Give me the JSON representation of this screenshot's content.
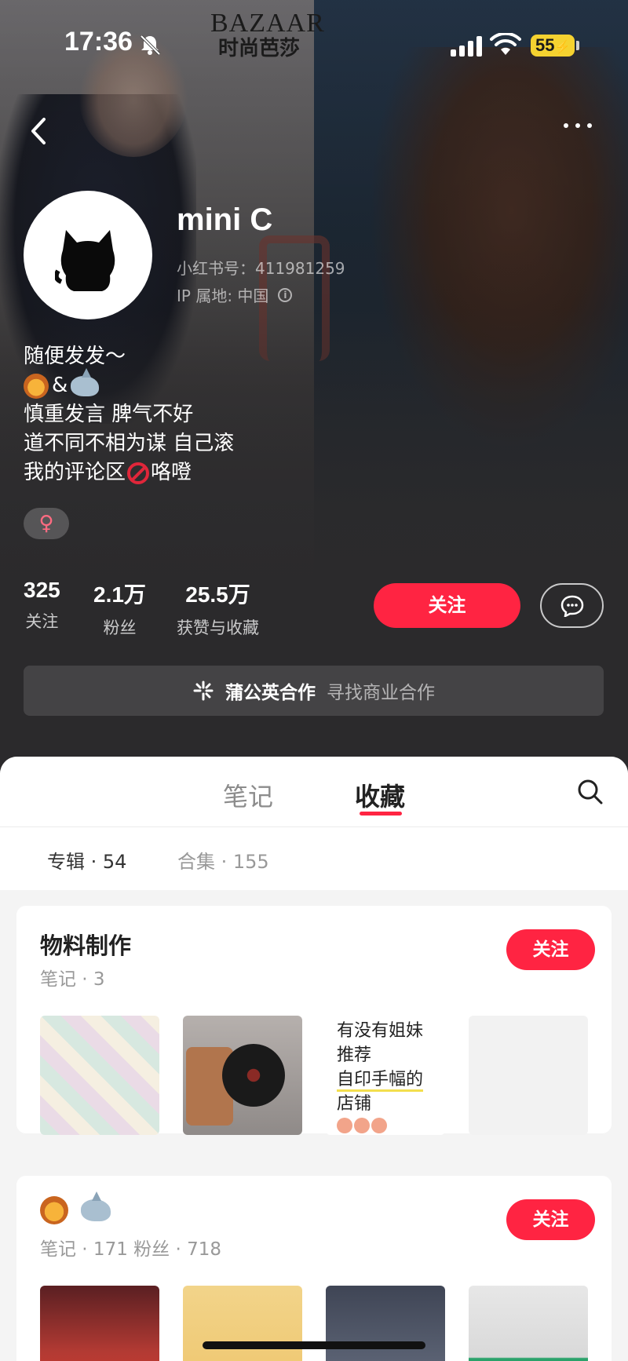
{
  "status_bar": {
    "time": "17:36",
    "battery": "55"
  },
  "banner": {
    "brand_en": "BAZAAR",
    "brand_cn": "时尚芭莎"
  },
  "profile": {
    "username": "mini C",
    "red_id": "小红书号：411981259",
    "ip_location": "IP 属地: 中国",
    "bio": {
      "line1": "随便发发～",
      "line2_amp": "&",
      "line3": "慎重发言 脾气不好",
      "line4": "道不同不相为谋 自己滚",
      "line5_pre": "我的评论区",
      "line5_post": "咯噔"
    },
    "gender": "♀"
  },
  "stats": [
    {
      "num": "325",
      "label": "关注"
    },
    {
      "num": "2.1万",
      "label": "粉丝"
    },
    {
      "num": "25.5万",
      "label": "获赞与收藏"
    }
  ],
  "actions": {
    "follow": "关注"
  },
  "collab": {
    "title": "蒲公英合作",
    "subtitle": "寻找商业合作"
  },
  "tabs": {
    "notes": "笔记",
    "collections": "收藏"
  },
  "subtabs": {
    "album": "专辑 · 54",
    "collection_set": "合集 · 155"
  },
  "albums": [
    {
      "title": "物料制作",
      "meta": "笔记 · 3",
      "follow": "关注",
      "text_thumb": [
        "有没有姐妹",
        "推荐",
        "自印手幅的",
        "店铺"
      ]
    },
    {
      "meta": "笔记 · 171   粉丝 · 718",
      "follow": "关注"
    }
  ],
  "colors": {
    "accent": "#ff2442",
    "hero_bg": "#2b2a2c"
  }
}
